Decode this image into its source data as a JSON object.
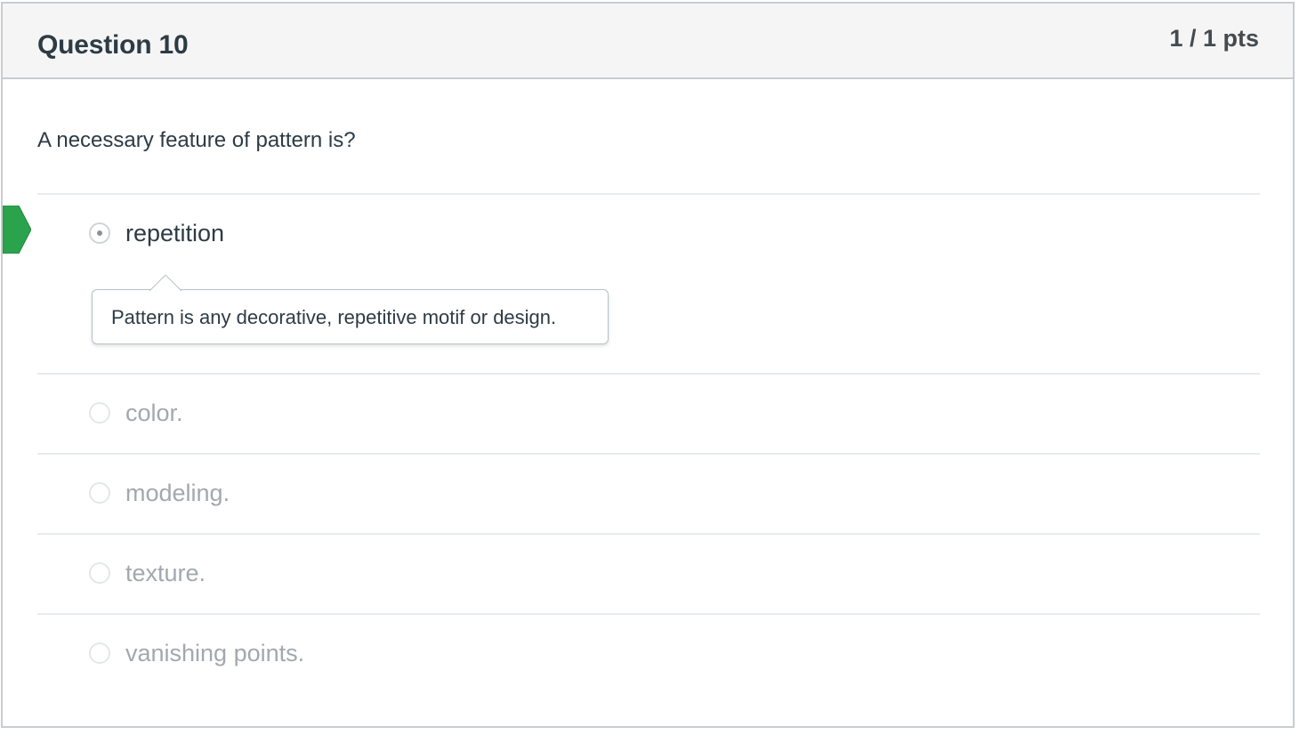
{
  "question": {
    "title": "Question 10",
    "points": "1 / 1 pts",
    "text": "A necessary feature of pattern is?"
  },
  "answers": [
    {
      "label": "repetition",
      "selected": true,
      "correct": true,
      "comment": "Pattern is any decorative, repetitive motif or design."
    },
    {
      "label": "color.",
      "selected": false
    },
    {
      "label": "modeling.",
      "selected": false
    },
    {
      "label": "texture.",
      "selected": false
    },
    {
      "label": "vanishing points.",
      "selected": false
    }
  ],
  "colors": {
    "correct_marker": "#2ba24c",
    "header_bg": "#f5f5f5",
    "border": "#c7cdd1",
    "text_dark": "#2d3b45",
    "text_muted": "#a4a8ac"
  },
  "icons": {
    "correct_marker": "correct-answer-arrow-icon",
    "radio_selected": "radio-selected-icon",
    "radio_empty": "radio-empty-icon"
  }
}
